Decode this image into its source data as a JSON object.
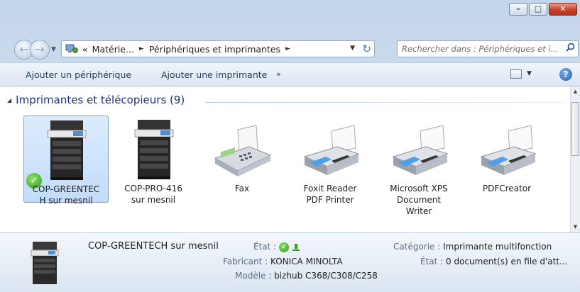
{
  "window": {
    "minimize_glyph": "–",
    "maximize_glyph": "□",
    "close_glyph": "✕"
  },
  "nav": {
    "back_glyph": "←",
    "forward_glyph": "→",
    "dropdown_glyph": "▼",
    "breadcrumb_prefix": "«",
    "breadcrumb": [
      "Matérie...",
      "Périphériques et imprimantes"
    ],
    "separator": "►",
    "address_dropdown": "▼",
    "refresh_glyph": "↻",
    "search_placeholder": "Rechercher dans : Périphériques et i...",
    "search_glyph": "⚲"
  },
  "toolbar": {
    "add_device": "Ajouter un périphérique",
    "add_printer": "Ajouter une imprimante",
    "more": "»",
    "view_dropdown": "▼",
    "help": "?"
  },
  "group": {
    "arrow": "◢",
    "title": "Imprimantes et télécopieurs (9)"
  },
  "devices": [
    {
      "line1": "COP-GREENTEC",
      "line2": "H sur mesnil",
      "line3": "",
      "icon": "mfp-printer-icon",
      "selected": true,
      "default": true
    },
    {
      "line1": "COP-PRO-416",
      "line2": "sur mesnil",
      "line3": "",
      "icon": "mfp-printer-icon",
      "selected": false,
      "default": false
    },
    {
      "line1": "Fax",
      "line2": "",
      "line3": "",
      "icon": "fax-icon",
      "selected": false,
      "default": false
    },
    {
      "line1": "Foxit Reader",
      "line2": "PDF Printer",
      "line3": "",
      "icon": "printer-icon",
      "selected": false,
      "default": false
    },
    {
      "line1": "Microsoft XPS",
      "line2": "Document",
      "line3": "Writer",
      "icon": "printer-icon",
      "selected": false,
      "default": false
    },
    {
      "line1": "PDFCreator",
      "line2": "",
      "line3": "",
      "icon": "printer-icon",
      "selected": false,
      "default": false
    }
  ],
  "scrollbar": {
    "up": "▲",
    "down": "▼"
  },
  "details": {
    "name": "COP-GREENTECH sur mesnil",
    "state_label": "État :",
    "manufacturer_label": "Fabricant :",
    "manufacturer": "KONICA MINOLTA",
    "model_label": "Modèle :",
    "model": "bizhub C368/C308/C258",
    "category_label": "Catégorie :",
    "category": "Imprimante multifonction",
    "status_label": "État :",
    "status": "0 document(s) en file d'att..."
  },
  "colors": {
    "accent": "#1e3287",
    "selection": "#c1dcfc",
    "close_button": "#c7462d"
  }
}
